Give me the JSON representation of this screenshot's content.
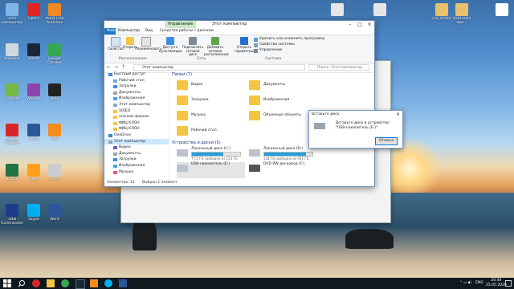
{
  "desktop": {
    "icons": [
      {
        "label": "Этот компьютер",
        "color": "#7fb4e6"
      },
      {
        "label": "Opera",
        "color": "#e02424"
      },
      {
        "label": "Avast Free Antivirus",
        "color": "#f08a24"
      },
      {
        "label": "Корзина",
        "color": "#cfd8dc"
      },
      {
        "label": "Steam",
        "color": "#1b2838"
      },
      {
        "label": "Google Chrome",
        "color": "#34a853"
      },
      {
        "label": "uTorrent",
        "color": "#75b843"
      },
      {
        "label": "WinRAR",
        "color": "#8e44ad"
      },
      {
        "label": "Nero",
        "color": "#222222"
      },
      {
        "label": "Adobe Reader",
        "color": "#d62828"
      },
      {
        "label": "Word",
        "color": "#2b579a"
      },
      {
        "label": "VLC",
        "color": "#f28c1c"
      },
      {
        "label": "Excel",
        "color": "#217346"
      },
      {
        "label": "AIMP",
        "color": "#ff9f1c"
      },
      {
        "label": "Фото",
        "color": "#cccccc"
      },
      {
        "label": "Total Commander",
        "color": "#1e3a8a"
      },
      {
        "label": "Skype",
        "color": "#00aff0"
      },
      {
        "label": "Word",
        "color": "#2b579a"
      }
    ],
    "right_icons": [
      {
        "label": "",
        "color": "#e6e6e6"
      },
      {
        "label": "",
        "color": "#e6e6e6"
      },
      {
        "label": "FLV_КЛОН",
        "color": "#e8c26a"
      },
      {
        "label": "описание при...",
        "color": "#e8c26a"
      },
      {
        "label": "",
        "color": "#ffffff"
      }
    ]
  },
  "explorer": {
    "title": "Этот компьютер",
    "context_tab": "Управление",
    "ribbon_tabs": [
      "Файл",
      "Компьютер",
      "Вид",
      "Средства работы с дисками"
    ],
    "ribbon": {
      "properties": "Свойства",
      "open": "Открыть",
      "rename": "Переименовать",
      "media_access": "Доступ к мультимедиа",
      "map_drive": "Подключить сетевой диск",
      "add_location": "Добавить сетевое расположение",
      "open_params": "Открыть параметры",
      "uninstall": "Удалить или изменить программу",
      "sys_props": "Свойства системы",
      "manage": "Управление",
      "group_location": "Расположение",
      "group_network": "Сеть",
      "group_system": "Система"
    },
    "address": "Этот компьютер",
    "search_placeholder": "Поиск: Этот компьютер",
    "nav": [
      "Быстрый доступ",
      "Рабочий стол",
      "Загрузки",
      "Документы",
      "Изображения",
      "Этот компьютер",
      "VIDEO",
      "агенсво фераль",
      "ФИЦ КЛОН",
      "ФИЦ КЛОН",
      "OneDrive",
      "Этот компьютер",
      "Видео",
      "Документы",
      "Загрузки",
      "Изображения",
      "Музыка"
    ],
    "folders_header": "Папки (7)",
    "folders": [
      "Видео",
      "Документы",
      "Загрузки",
      "Изображения",
      "Музыка",
      "Объемные объекты",
      "Рабочий стол"
    ],
    "drives_header": "Устройства и диски (5)",
    "drives": [
      {
        "name": "Локальный диск (C:)",
        "detail": "77,5 ГБ свободно из 223 ГБ",
        "used": 0.65
      },
      {
        "name": "Локальный диск (D:)",
        "detail": "134 ГБ свободно из 931 ГБ",
        "used": 0.86
      },
      {
        "name": "USB-накопитель (E:)",
        "detail": "",
        "used": null
      },
      {
        "name": "DVD RW дисковод (F:)",
        "detail": "",
        "used": null
      }
    ],
    "status_items": "Элементов: 12",
    "status_selected": "Выбран 1 элемент"
  },
  "dialog": {
    "title": "Вставьте диск",
    "message_line1": "Вставьте диск в устройство",
    "message_line2": "\"USB-накопитель (E:)\".",
    "cancel": "Отмена"
  },
  "taskbar": {
    "time": "20:40",
    "date": "25.05.2020",
    "lang": "ENG"
  }
}
